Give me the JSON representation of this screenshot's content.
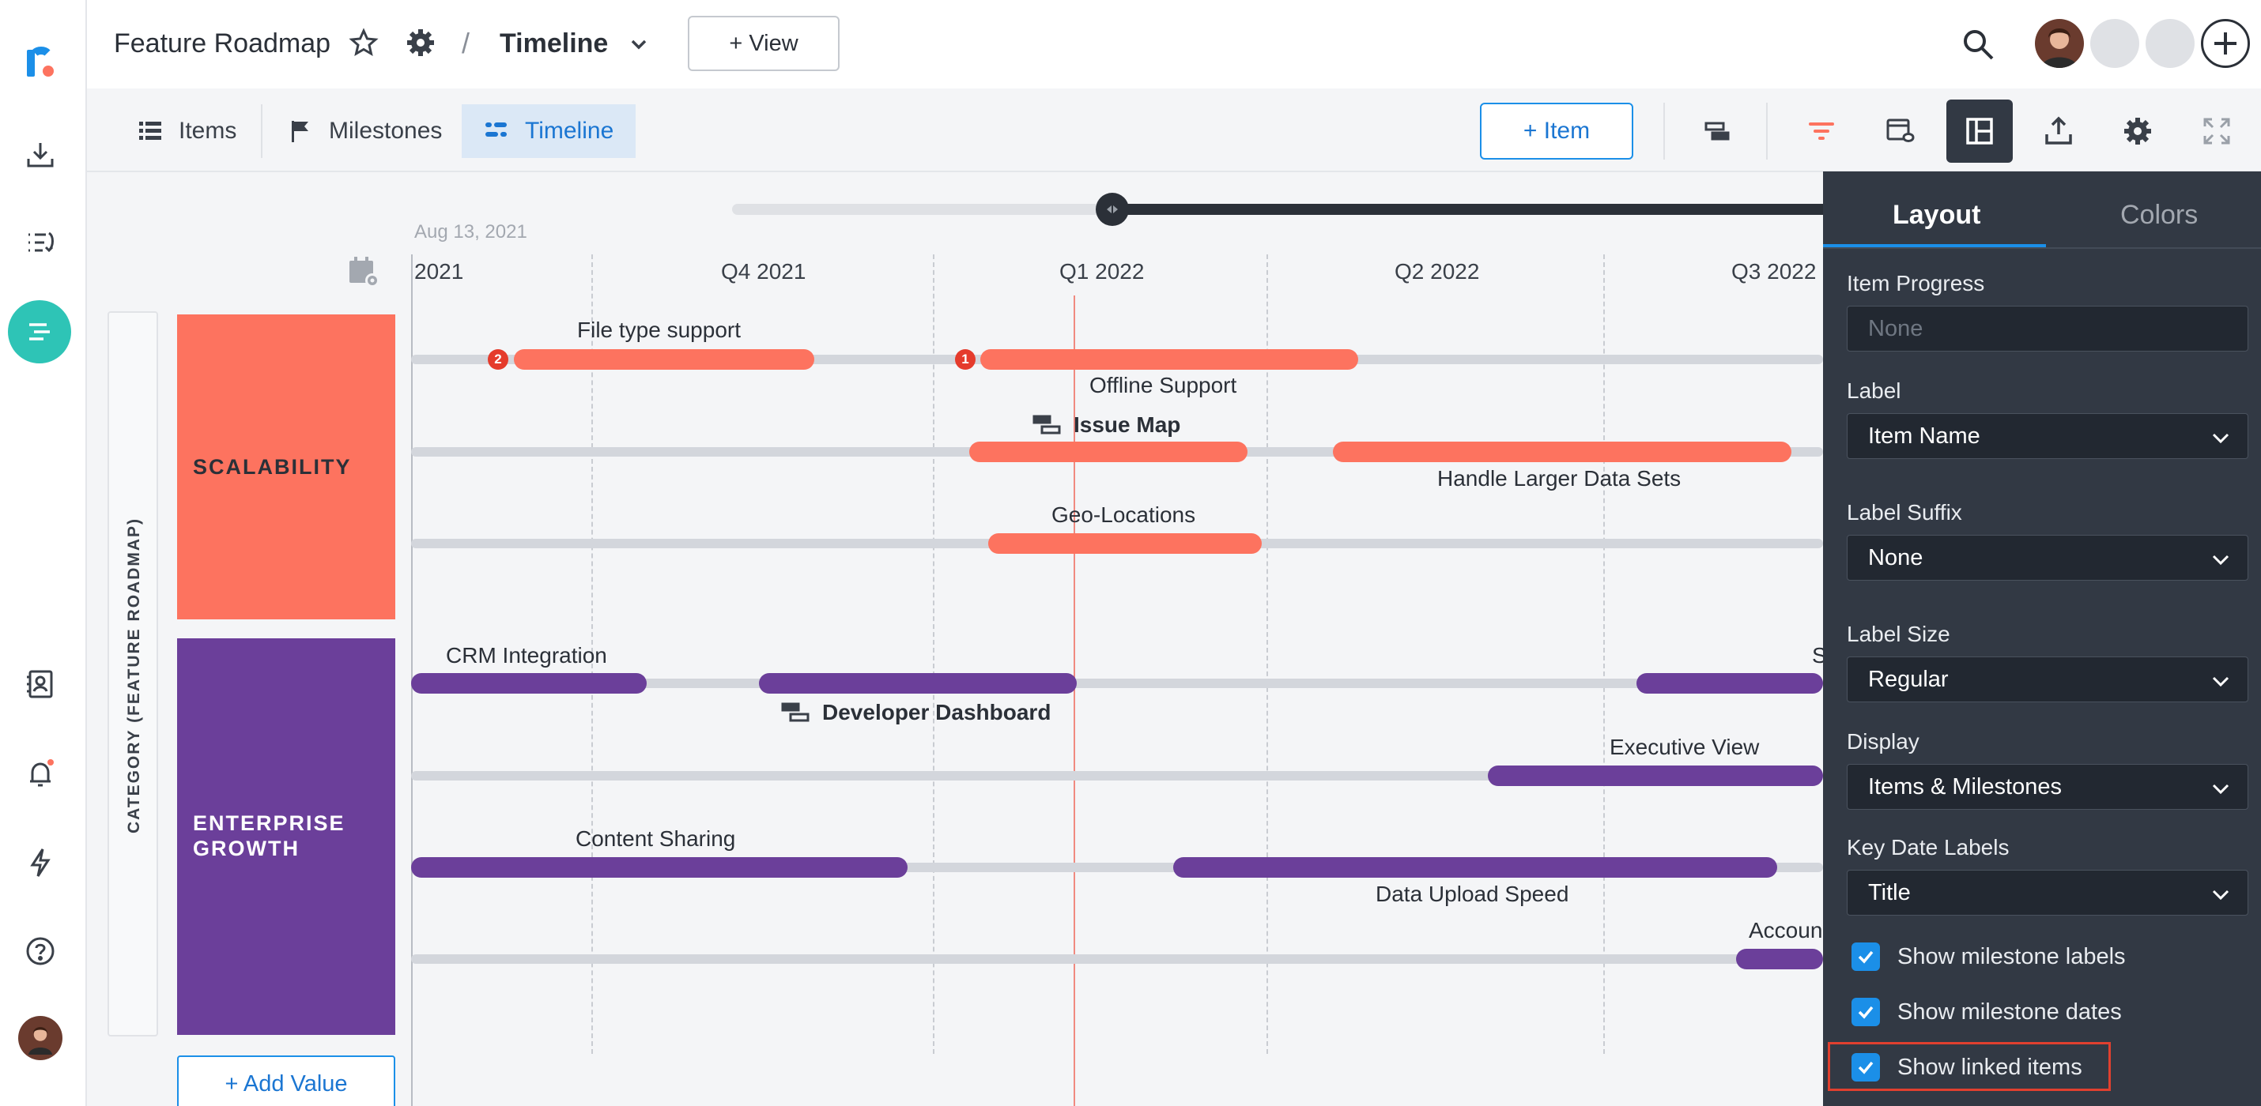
{
  "header": {
    "roadmap_title": "Feature Roadmap",
    "separator": "/",
    "view_name": "Timeline",
    "add_view_label": "+ View"
  },
  "subbar": {
    "tabs": [
      {
        "label": "Items",
        "icon": "list-icon"
      },
      {
        "label": "Milestones",
        "icon": "flag-icon"
      },
      {
        "label": "Timeline",
        "icon": "timeline-icon",
        "active": true
      }
    ],
    "add_item_label": "+ Item"
  },
  "timeline": {
    "date_label": "Aug 13, 2021",
    "quarters": [
      "2021",
      "Q4 2021",
      "Q1 2022",
      "Q2 2022",
      "Q3 2022"
    ],
    "category_axis_label": "CATEGORY (FEATURE ROADMAP)",
    "groups": [
      {
        "name": "SCALABILITY",
        "color": "#fd735f"
      },
      {
        "name": "ENTERPRISE GROWTH",
        "color": "#6b3f9a"
      }
    ],
    "items": {
      "file_type_support": "File type support",
      "offline_support": "Offline Support",
      "issue_map": "Issue Map",
      "handle_larger": "Handle Larger Data Sets",
      "geo_locations": "Geo-Locations",
      "crm_integration": "CRM Integration",
      "developer_dashboard": "Developer Dashboard",
      "executive_view": "Executive View",
      "content_sharing": "Content Sharing",
      "data_upload_speed": "Data Upload Speed",
      "accoun_partial": "Accoun",
      "s_partial": "S"
    },
    "badges": [
      "2",
      "1"
    ],
    "add_value_label": "+  Add Value"
  },
  "panel": {
    "tabs": [
      "Layout",
      "Colors"
    ],
    "fields": [
      {
        "label": "Item Progress",
        "value": "None",
        "placeholder": true
      },
      {
        "label": "Label",
        "value": "Item Name"
      },
      {
        "label": "Label Suffix",
        "value": "None"
      },
      {
        "label": "Label Size",
        "value": "Regular"
      },
      {
        "label": "Display",
        "value": "Items & Milestones"
      },
      {
        "label": "Key Date Labels",
        "value": "Title"
      }
    ],
    "checks": [
      {
        "label": "Show milestone labels",
        "checked": true
      },
      {
        "label": "Show milestone dates",
        "checked": true
      },
      {
        "label": "Show linked items",
        "checked": true,
        "highlighted": true
      }
    ]
  },
  "colors": {
    "accent": "#1b8fe8",
    "red_bar": "#fd735f",
    "purple_bar": "#6b3f9a",
    "today_line": "#f08a80",
    "panel_bg": "#323944",
    "highlight_box": "#e0402f"
  }
}
